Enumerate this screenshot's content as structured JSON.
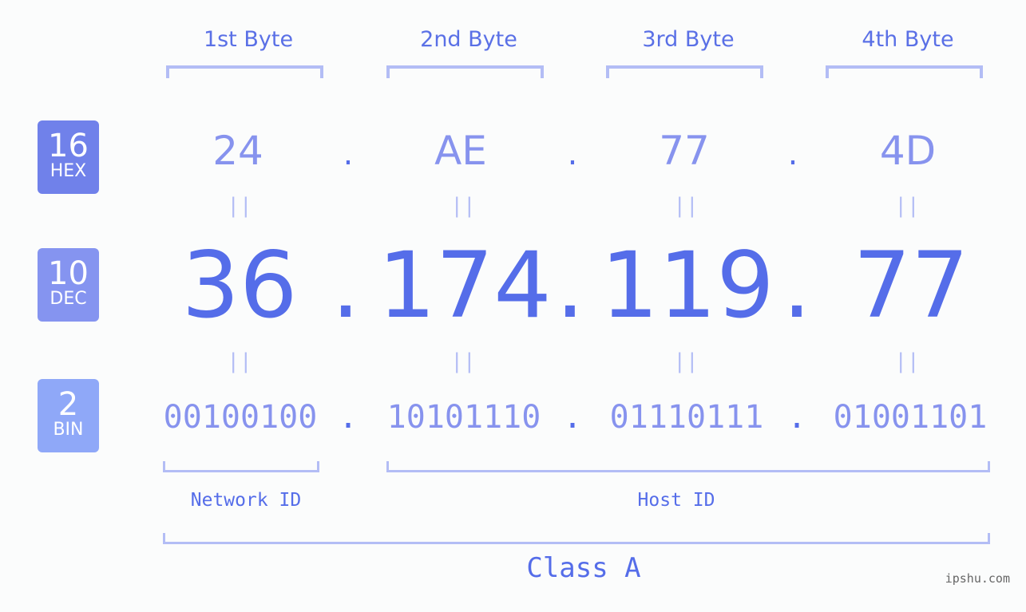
{
  "bytes": [
    {
      "label": "1st Byte",
      "hex": "24",
      "dec": "36",
      "bin": "00100100"
    },
    {
      "label": "2nd Byte",
      "hex": "AE",
      "dec": "174",
      "bin": "10101110"
    },
    {
      "label": "3rd Byte",
      "hex": "77",
      "dec": "119",
      "bin": "01110111"
    },
    {
      "label": "4th Byte",
      "hex": "4D",
      "dec": "77",
      "bin": "01001101"
    }
  ],
  "separator": ".",
  "equals_sign": "=",
  "bases": [
    {
      "number": "16",
      "name": "HEX",
      "color": "#7081ea"
    },
    {
      "number": "10",
      "name": "DEC",
      "color": "#8594f0"
    },
    {
      "number": "2",
      "name": "BIN",
      "color": "#8fa8f8"
    }
  ],
  "network_id_label": "Network ID",
  "host_id_label": "Host ID",
  "class_label": "Class A",
  "watermark": "ipshu.com",
  "colors": {
    "primary": "#556de9",
    "light": "#8793ee",
    "bracket": "#b3bdf5"
  }
}
